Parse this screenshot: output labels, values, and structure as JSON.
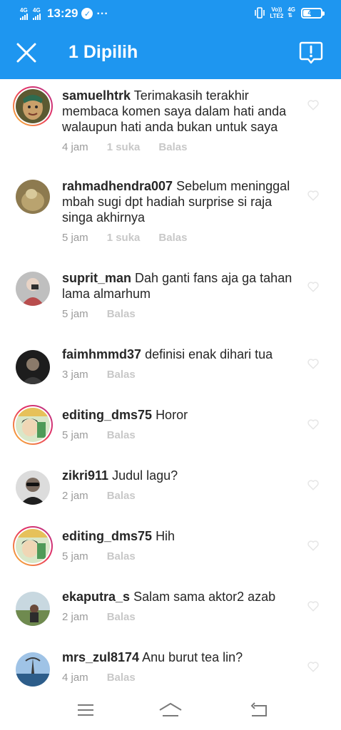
{
  "status_bar": {
    "sim1_label": "4G",
    "sim2_label": "4G",
    "time": "13:29",
    "lte_top": "Vo))",
    "lte_bottom": "LTE2",
    "network_label": "4G",
    "battery_level": "44"
  },
  "header": {
    "title": "1 Dipilih",
    "close_icon": "close-icon",
    "report_icon": "report-icon"
  },
  "comments": [
    {
      "username": "samuelhtrk",
      "text": "Terimakasih terakhir membaca komen saya dalam hati anda walaupun hati anda bukan untuk saya",
      "time": "4 jam",
      "likes": "1 suka",
      "reply": "Balas"
    },
    {
      "username": "rahmadhendra007",
      "text": "Sebelum meninggal mbah sugi dpt hadiah surprise si raja singa akhirnya",
      "time": "5 jam",
      "likes": "1 suka",
      "reply": "Balas"
    },
    {
      "username": "suprit_man",
      "text": "Dah ganti fans aja ga tahan lama almarhum",
      "time": "5 jam",
      "reply": "Balas"
    },
    {
      "username": "faimhmmd37",
      "text": "definisi enak dihari tua",
      "time": "3 jam",
      "reply": "Balas"
    },
    {
      "username": "editing_dms75",
      "text": "Horor",
      "time": "5 jam",
      "reply": "Balas"
    },
    {
      "username": "zikri911",
      "text": "Judul lagu?",
      "time": "2 jam",
      "reply": "Balas"
    },
    {
      "username": "editing_dms75",
      "text": "Hih",
      "time": "5 jam",
      "reply": "Balas"
    },
    {
      "username": "ekaputra_s",
      "text": "Salam sama aktor2 azab",
      "time": "2 jam",
      "reply": "Balas"
    },
    {
      "username": "mrs_zul8174",
      "text": "Anu burut tea lin?",
      "time": "4 jam",
      "reply": "Balas"
    }
  ],
  "colors": {
    "brand": "#1e96f0",
    "text": "#262626",
    "meta": "#9b9b9b",
    "story_ring": "#e9325f"
  },
  "nav": {
    "menu_icon": "menu-icon",
    "home_icon": "home-icon",
    "back_icon": "back-icon"
  }
}
